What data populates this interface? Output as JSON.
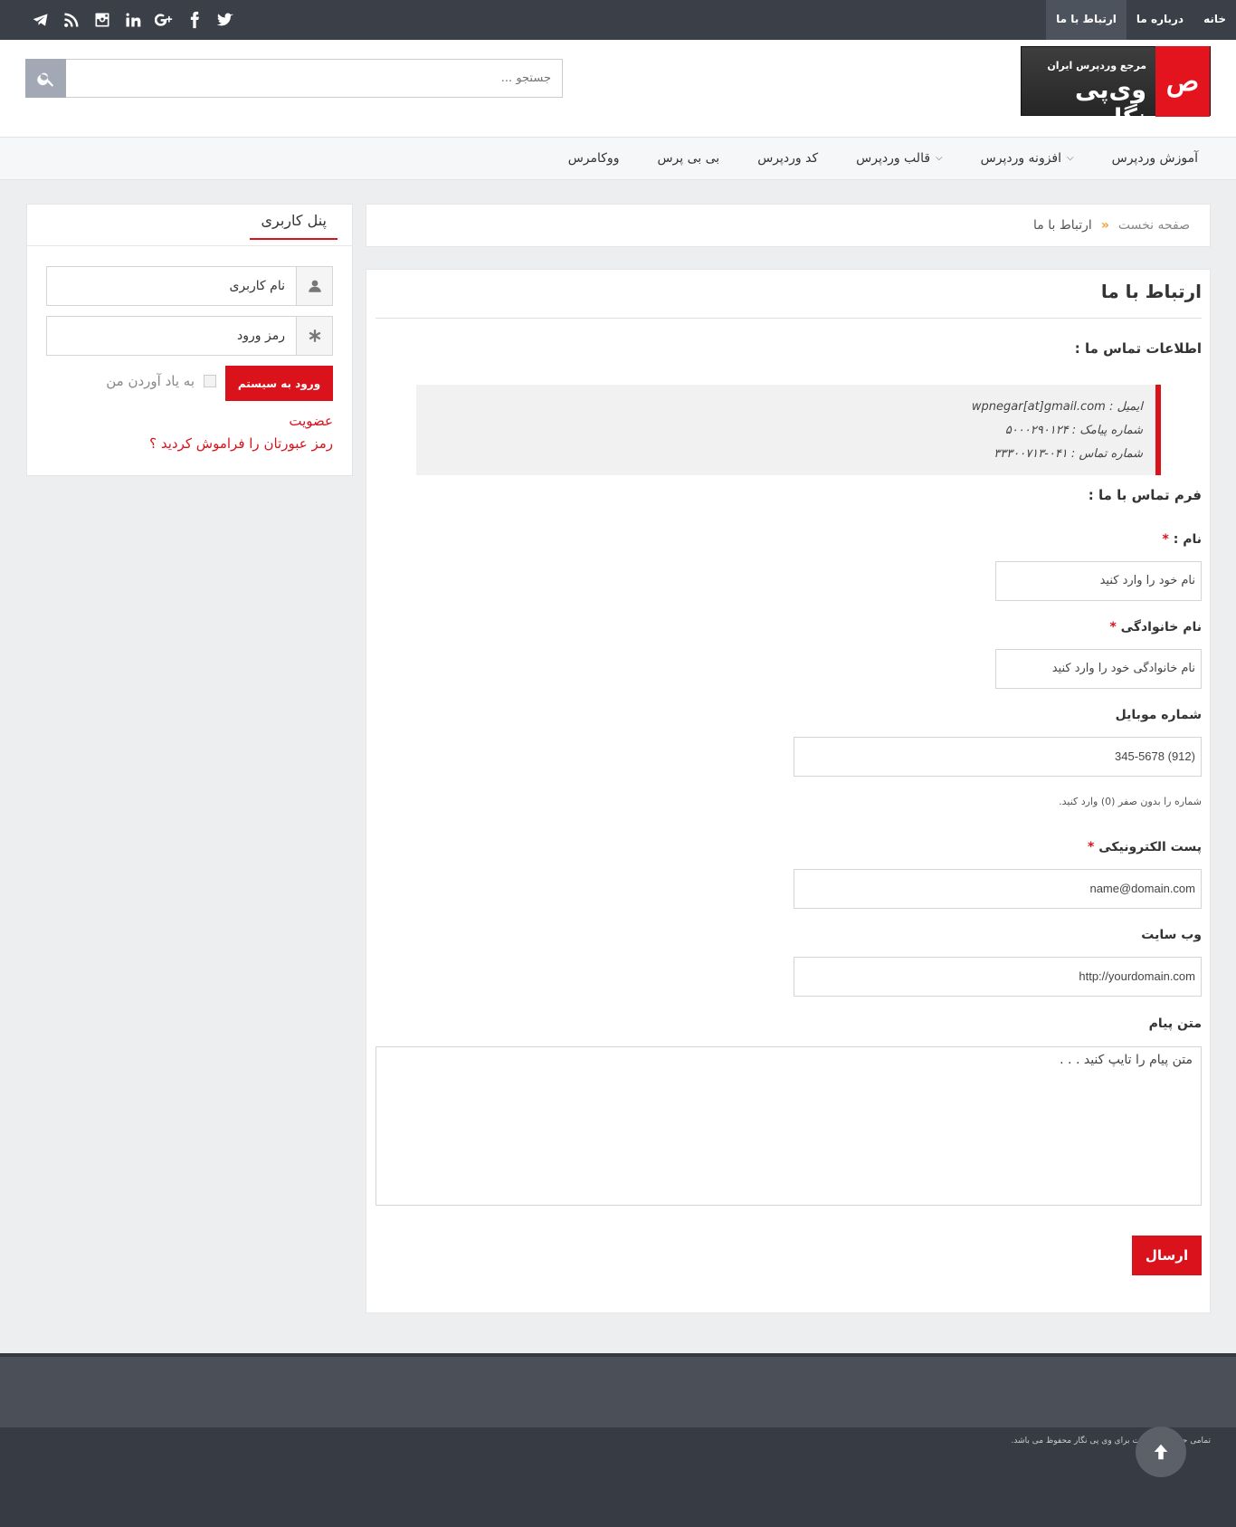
{
  "topbar": {
    "nav": [
      {
        "label": "خانه",
        "active": false
      },
      {
        "label": "درباره ما",
        "active": false
      },
      {
        "label": "ارتباط با ما",
        "active": true
      }
    ],
    "social_icons": [
      "twitter-icon",
      "facebook-icon",
      "google-plus-icon",
      "linkedin-icon",
      "instagram-icon",
      "rss-icon",
      "telegram-icon"
    ]
  },
  "header": {
    "logo": {
      "tagline": "مرجع وردپرس ایران",
      "name": "وی‌پی نگار",
      "mark": "ص"
    },
    "search": {
      "placeholder": "جستجو ..."
    }
  },
  "mainnav": {
    "items": [
      {
        "label": "آموزش وردپرس",
        "has_dropdown": false
      },
      {
        "label": "افزونه وردپرس",
        "has_dropdown": true
      },
      {
        "label": "قالب وردپرس",
        "has_dropdown": true
      },
      {
        "label": "کد وردپرس",
        "has_dropdown": false
      },
      {
        "label": "بی بی پرس",
        "has_dropdown": false
      },
      {
        "label": "ووکامرس",
        "has_dropdown": false
      }
    ]
  },
  "breadcrumb": {
    "home": "صفحه نخست",
    "separator": "»",
    "current": "ارتباط با ما"
  },
  "content": {
    "title": "ارتباط با ما",
    "contact_info_heading": "اطلاعات تماس ما :",
    "contact_lines": [
      "ایمیل : wpnegar[at]gmail.com",
      "شماره پیامک : ۵۰۰۰۲۹۰۱۲۴",
      "شماره تماس : ۰۴۱-۳۳۳۰۰۷۱۳"
    ],
    "form_heading": "فرم تماس با ما :",
    "form": {
      "first_name": {
        "label": "نام :",
        "required_mark": "*",
        "placeholder": "نام خود را وارد کنید"
      },
      "last_name": {
        "label": "نام خانوادگی",
        "required_mark": "*",
        "placeholder": "نام خانوادگی خود را وارد کنید"
      },
      "mobile": {
        "label": "شماره موبایل",
        "placeholder": "(912) 345-5678",
        "hint": "شماره را بدون صفر (0) وارد کنید."
      },
      "email": {
        "label": "پست الکترونیکی",
        "required_mark": "*",
        "placeholder": "name@domain.com"
      },
      "website": {
        "label": "وب سایت",
        "placeholder": "http://yourdomain.com"
      },
      "message": {
        "label": "متن پیام",
        "placeholder": "متن پیام را تایپ کنید . . ."
      },
      "submit_label": "ارسال"
    }
  },
  "user_panel": {
    "title": "پنل کاربری",
    "username_placeholder": "نام کاربری",
    "password_placeholder": "رمز ورود",
    "login_label": "ورود به سیستم",
    "remember_label": "به یاد آوردن من",
    "register_link": "عضویت",
    "forgot_link": "رمز عبورتان را فراموش کردید ؟"
  },
  "footer": {
    "copyright": "تمامی حقوق این سایت برای وی پی نگار محفوظ می باشد."
  },
  "colors": {
    "accent": "#d9121b",
    "topbar": "#3a3f48",
    "footer": "#4a4f58"
  }
}
